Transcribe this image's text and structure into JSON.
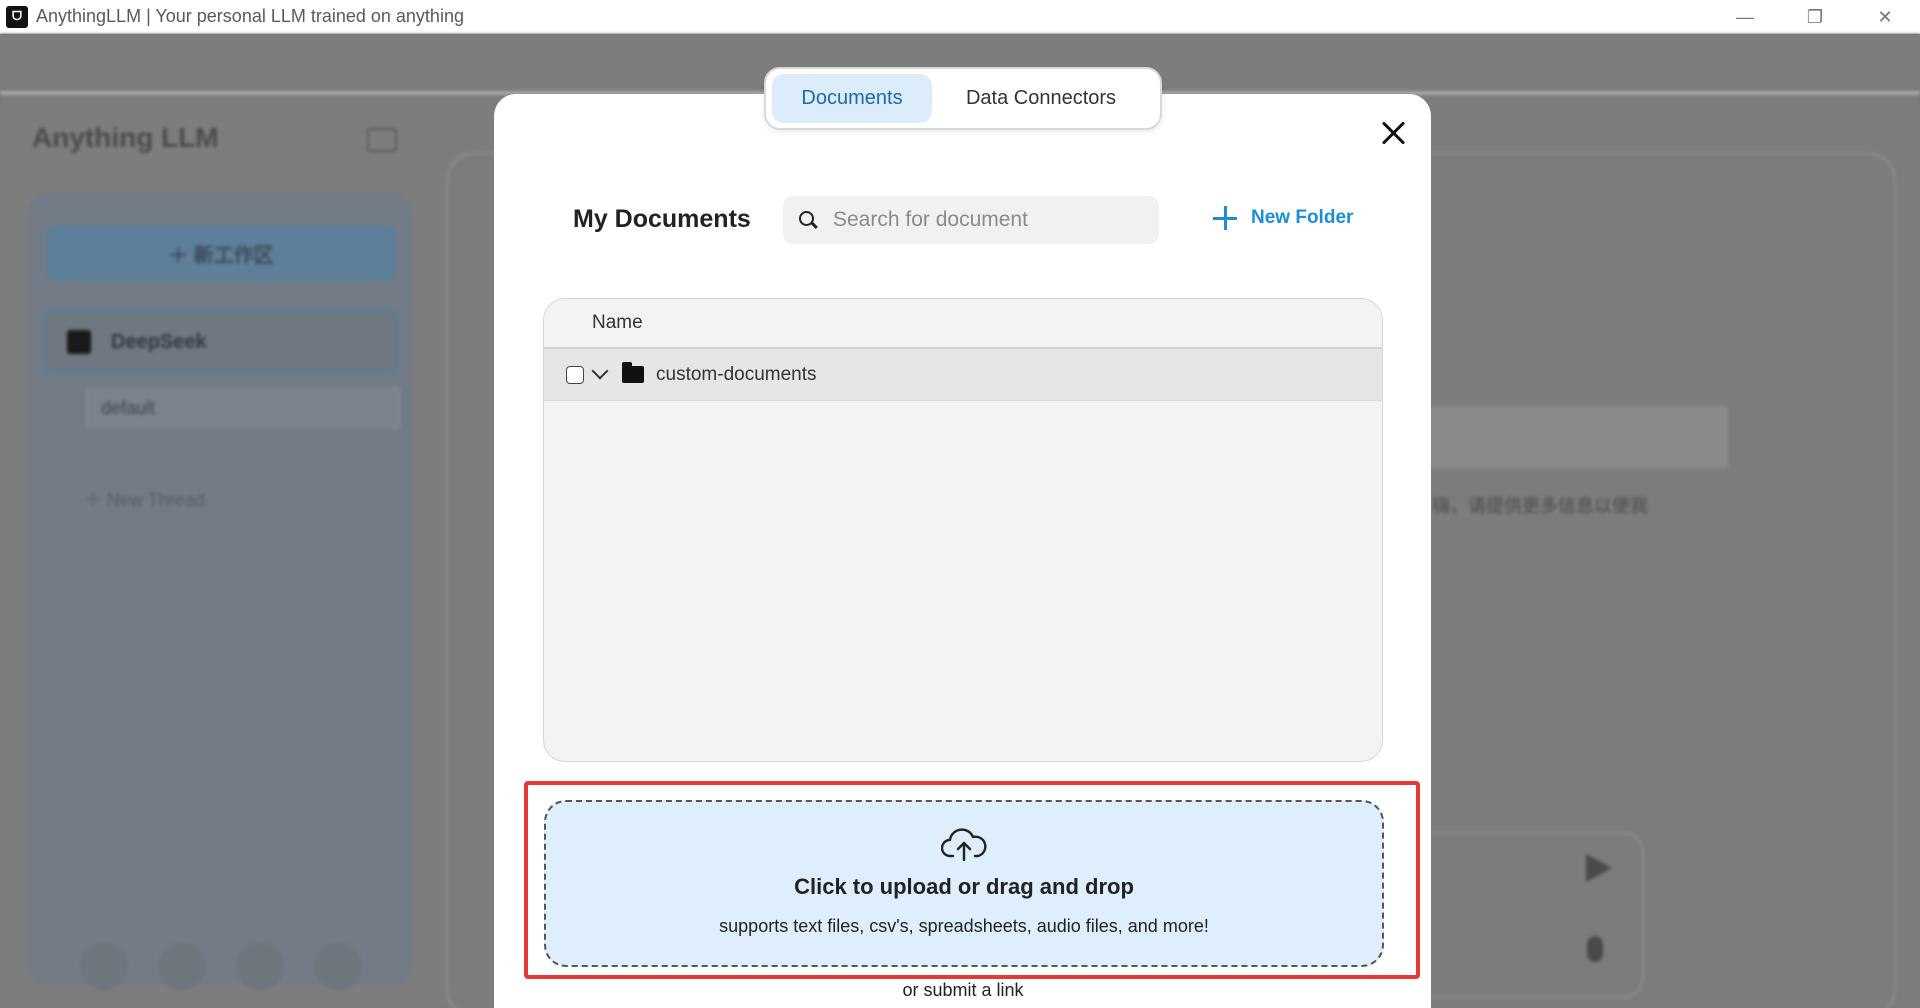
{
  "window": {
    "title": "AnythingLLM | Your personal LLM trained on anything",
    "app_icon_text": "ᗜ",
    "controls": {
      "minimize": "—",
      "maximize": "❐",
      "close": "✕"
    }
  },
  "background": {
    "logo": "Anything LLM",
    "new_workspace": "＋ 新工作区",
    "workspace": "DeepSeek",
    "thread": "default",
    "new_thread": "＋   New Thread",
    "partial_text": "嗨，请提供更多信息以便我"
  },
  "modal": {
    "tabs": [
      {
        "label": "Documents",
        "active": true
      },
      {
        "label": "Data Connectors",
        "active": false
      }
    ],
    "heading": "My Documents",
    "search": {
      "placeholder": "Search for document",
      "value": ""
    },
    "new_folder": "New Folder",
    "table": {
      "columns": [
        "Name"
      ],
      "rows": [
        {
          "name": "custom-documents",
          "type": "folder",
          "checked": false
        }
      ]
    },
    "upload": {
      "title": "Click to upload or drag and drop",
      "subtitle": "supports text files, csv's, spreadsheets, audio files, and more!",
      "link_text": "or submit a link"
    }
  },
  "colors": {
    "accent": "#1a8fd6",
    "active_tab_bg": "#dcecfb",
    "dropzone_bg": "#dfeefc",
    "highlight": "#e53935"
  }
}
